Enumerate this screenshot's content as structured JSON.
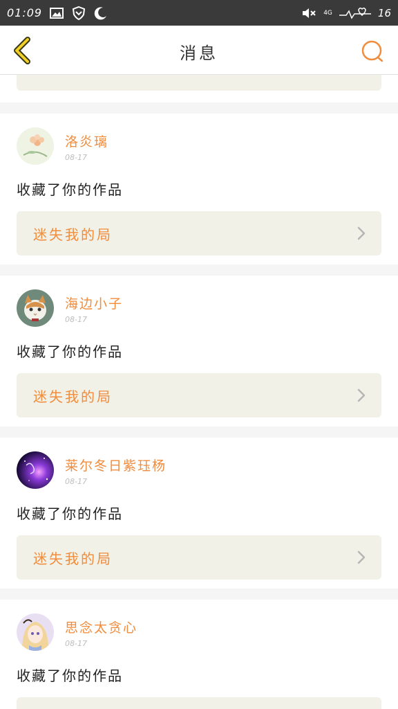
{
  "status_bar": {
    "time": "01:09",
    "network": "4G",
    "battery": "16",
    "icons": [
      "image-icon",
      "shield-icon",
      "moon-icon",
      "mute-icon",
      "heart-wave-icon"
    ]
  },
  "header": {
    "title": "消息",
    "back_icon": "chevron-left-icon",
    "search_icon": "search-icon"
  },
  "colors": {
    "accent": "#f08c3c",
    "link_bg": "#f1f1e7",
    "status_bg": "#3a3a3a"
  },
  "messages": [
    {
      "username": "洛炎璃",
      "date": "08-17",
      "action": "收藏了你的作品",
      "work_title": "迷失我的局",
      "avatar": "flower-avatar"
    },
    {
      "username": "海边小子",
      "date": "08-17",
      "action": "收藏了你的作品",
      "work_title": "迷失我的局",
      "avatar": "cat-avatar"
    },
    {
      "username": "莱尔冬日紫珏杨",
      "date": "08-17",
      "action": "收藏了你的作品",
      "work_title": "迷失我的局",
      "avatar": "galaxy-avatar"
    },
    {
      "username": "思念太贪心",
      "date": "08-17",
      "action": "收藏了你的作品",
      "work_title": "",
      "avatar": "anime-girl-avatar"
    }
  ]
}
